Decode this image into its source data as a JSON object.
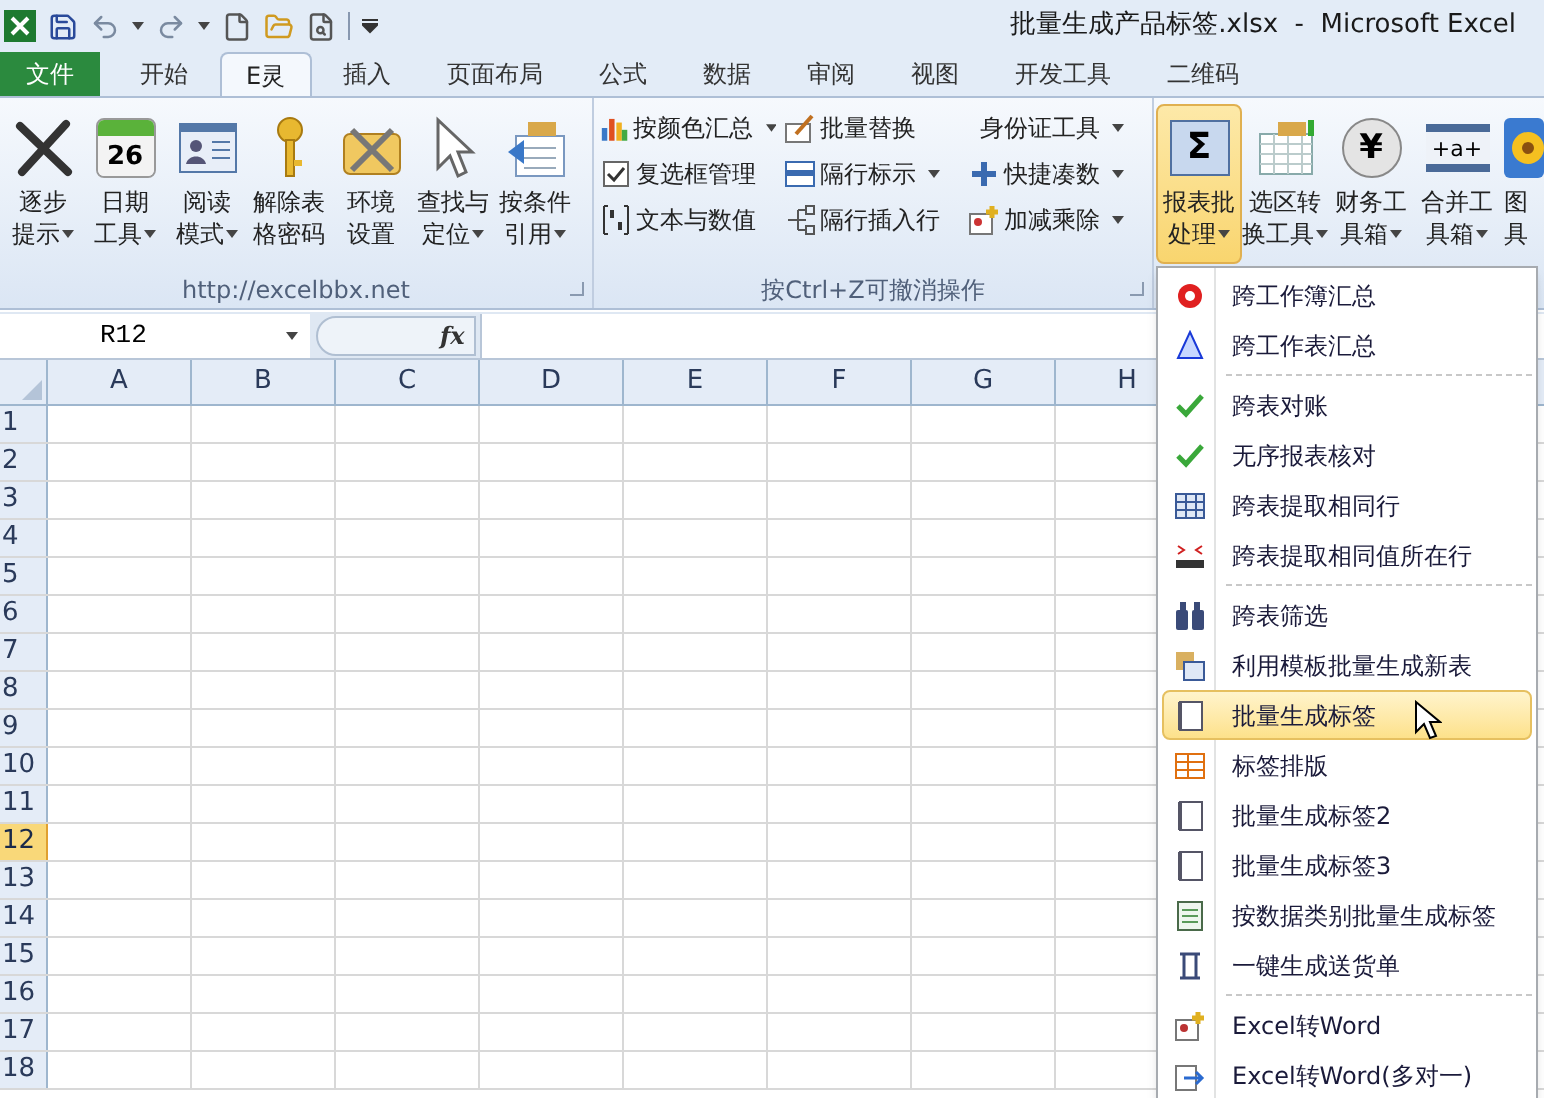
{
  "title_bar": {
    "title": "批量生成产品标签.xlsx  -  Microsoft Excel"
  },
  "tabs": [
    {
      "label": "文件",
      "kind": "file"
    },
    {
      "label": "开始",
      "kind": "tab",
      "selected": false
    },
    {
      "label": "E灵",
      "kind": "tab",
      "selected": true
    },
    {
      "label": "插入",
      "kind": "tab",
      "selected": false
    },
    {
      "label": "页面布局",
      "kind": "tab",
      "selected": false
    },
    {
      "label": "公式",
      "kind": "tab",
      "selected": false
    },
    {
      "label": "数据",
      "kind": "tab",
      "selected": false
    },
    {
      "label": "审阅",
      "kind": "tab",
      "selected": false
    },
    {
      "label": "视图",
      "kind": "tab",
      "selected": false
    },
    {
      "label": "开发工具",
      "kind": "tab",
      "selected": false
    },
    {
      "label": "二维码",
      "kind": "tab",
      "selected": false
    }
  ],
  "ribbon": {
    "groups": [
      {
        "kind": "large",
        "label": "http://excelbbx.net",
        "buttons": [
          {
            "lines": [
              "逐步",
              "提示"
            ],
            "has_menu": true,
            "active": false
          },
          {
            "lines": [
              "日期",
              "工具"
            ],
            "has_menu": true,
            "active": false,
            "icon_text": "26"
          },
          {
            "lines": [
              "阅读",
              "模式"
            ],
            "has_menu": true,
            "active": false
          },
          {
            "lines": [
              "解除表",
              "格密码"
            ],
            "has_menu": false,
            "active": false
          },
          {
            "lines": [
              "环境",
              "设置"
            ],
            "has_menu": false,
            "active": false
          },
          {
            "lines": [
              "查找与",
              "定位"
            ],
            "has_menu": true,
            "active": false
          },
          {
            "lines": [
              "按条件",
              "引用"
            ],
            "has_menu": true,
            "active": false
          }
        ]
      },
      {
        "kind": "small",
        "label": "按Ctrl+Z可撤消操作",
        "columns": [
          [
            {
              "label": "按颜色汇总",
              "has_menu": true
            },
            {
              "label": "复选框管理",
              "has_menu": false
            },
            {
              "label": "文本与数值",
              "has_menu": false
            }
          ],
          [
            {
              "label": "批量替换",
              "has_menu": false
            },
            {
              "label": "隔行标示",
              "has_menu": true
            },
            {
              "label": "隔行插入行",
              "has_menu": false
            }
          ],
          [
            {
              "label": "身份证工具",
              "has_menu": true
            },
            {
              "label": "快捷凑数",
              "has_menu": true
            },
            {
              "label": "加减乘除",
              "has_menu": true
            }
          ]
        ]
      },
      {
        "kind": "large",
        "buttons": [
          {
            "lines": [
              "报表批",
              "处理"
            ],
            "has_menu": true,
            "active": true,
            "icon_text": "Σ"
          },
          {
            "lines": [
              "选区转",
              "换工具"
            ],
            "has_menu": true,
            "active": false
          },
          {
            "lines": [
              "财务工",
              "具箱"
            ],
            "has_menu": true,
            "active": false,
            "icon_text": "¥"
          },
          {
            "lines": [
              "合并工",
              "具箱"
            ],
            "has_menu": true,
            "active": false,
            "icon_text": "+a+"
          },
          {
            "lines": [
              "图",
              "具"
            ],
            "has_menu": false,
            "active": false
          }
        ]
      }
    ]
  },
  "formula_bar": {
    "name_box": "R12",
    "function_button": "fx"
  },
  "sheet": {
    "columns": [
      {
        "label": "A"
      },
      {
        "label": "B"
      },
      {
        "label": "C"
      },
      {
        "label": "D"
      },
      {
        "label": "E"
      },
      {
        "label": "F"
      },
      {
        "label": "G"
      },
      {
        "label": "H"
      }
    ],
    "rows": [
      {
        "label": "1",
        "selected": false
      },
      {
        "label": "2",
        "selected": false
      },
      {
        "label": "3",
        "selected": false
      },
      {
        "label": "4",
        "selected": false
      },
      {
        "label": "5",
        "selected": false
      },
      {
        "label": "6",
        "selected": false
      },
      {
        "label": "7",
        "selected": false
      },
      {
        "label": "8",
        "selected": false
      },
      {
        "label": "9",
        "selected": false
      },
      {
        "label": "10",
        "selected": false
      },
      {
        "label": "11",
        "selected": false
      },
      {
        "label": "12",
        "selected": true
      },
      {
        "label": "13",
        "selected": false
      },
      {
        "label": "14",
        "selected": false
      },
      {
        "label": "15",
        "selected": false
      },
      {
        "label": "16",
        "selected": false
      },
      {
        "label": "17",
        "selected": false
      },
      {
        "label": "18",
        "selected": false
      }
    ]
  },
  "menu": {
    "items": [
      {
        "kind": "item",
        "label": "跨工作簿汇总",
        "selected": false
      },
      {
        "kind": "item",
        "label": "跨工作表汇总",
        "selected": false
      },
      {
        "kind": "separator"
      },
      {
        "kind": "item",
        "label": "跨表对账",
        "selected": false
      },
      {
        "kind": "item",
        "label": "无序报表核对",
        "selected": false
      },
      {
        "kind": "item",
        "label": "跨表提取相同行",
        "selected": false
      },
      {
        "kind": "item",
        "label": "跨表提取相同值所在行",
        "selected": false
      },
      {
        "kind": "separator"
      },
      {
        "kind": "item",
        "label": "跨表筛选",
        "selected": false
      },
      {
        "kind": "item",
        "label": "利用模板批量生成新表",
        "selected": false
      },
      {
        "kind": "item",
        "label": "批量生成标签",
        "selected": true
      },
      {
        "kind": "item",
        "label": "标签排版",
        "selected": false
      },
      {
        "kind": "item",
        "label": "批量生成标签2",
        "selected": false
      },
      {
        "kind": "item",
        "label": "批量生成标签3",
        "selected": false
      },
      {
        "kind": "item",
        "label": "按数据类别批量生成标签",
        "selected": false
      },
      {
        "kind": "item",
        "label": "一键生成送货单",
        "selected": false
      },
      {
        "kind": "separator"
      },
      {
        "kind": "item",
        "label": "Excel转Word",
        "selected": false
      },
      {
        "kind": "item",
        "label": "Excel转Word(多对一)",
        "selected": false
      }
    ]
  }
}
